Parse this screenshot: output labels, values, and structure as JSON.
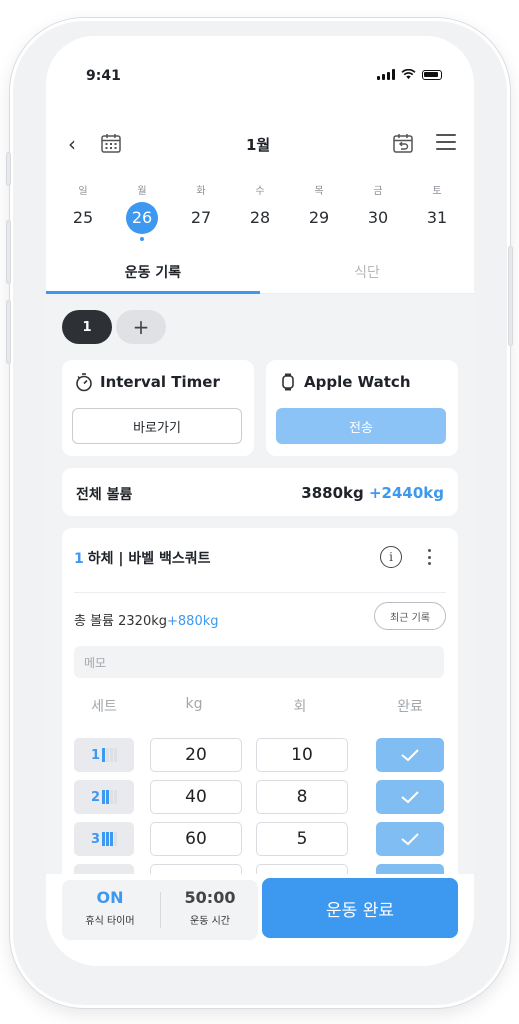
{
  "status_bar": {
    "time": "9:41"
  },
  "header": {
    "month": "1월"
  },
  "week": [
    {
      "label": "일",
      "date": "25",
      "selected": false
    },
    {
      "label": "월",
      "date": "26",
      "selected": true
    },
    {
      "label": "화",
      "date": "27",
      "selected": false
    },
    {
      "label": "수",
      "date": "28",
      "selected": false
    },
    {
      "label": "목",
      "date": "29",
      "selected": false
    },
    {
      "label": "금",
      "date": "30",
      "selected": false
    },
    {
      "label": "토",
      "date": "31",
      "selected": false
    }
  ],
  "tabs": {
    "workout": "운동 기록",
    "diet": "식단"
  },
  "session_tabs": {
    "current": "1",
    "add": "+"
  },
  "tools": {
    "interval": {
      "title": "Interval Timer",
      "button": "바로가기"
    },
    "watch": {
      "title": "Apple Watch",
      "button": "전송"
    }
  },
  "volume": {
    "label": "전체 볼륨",
    "value": "3880kg",
    "delta": "+2440kg"
  },
  "exercise": {
    "number": "1",
    "name": "하체 | 바벨 백스쿼트",
    "total_label": "총 볼륨 2320kg",
    "total_delta": "+880kg",
    "recent_button": "최근 기록",
    "memo_placeholder": "메모",
    "columns": {
      "set": "세트",
      "kg": "kg",
      "reps": "회",
      "done": "완료"
    },
    "sets": [
      {
        "set": "1",
        "kg": "20",
        "reps": "10",
        "done": true,
        "level": 1
      },
      {
        "set": "2",
        "kg": "40",
        "reps": "8",
        "done": true,
        "level": 2
      },
      {
        "set": "3",
        "kg": "60",
        "reps": "5",
        "done": true,
        "level": 3
      }
    ]
  },
  "bottom": {
    "rest_timer": {
      "value": "ON",
      "label": "휴식 타이머"
    },
    "workout_time": {
      "value": "50:00",
      "label": "운동 시간"
    },
    "finish_button": "운동 완료"
  },
  "colors": {
    "accent": "#3d98ef",
    "accent_light": "#8cc3f6",
    "dark_pill": "#2d3035"
  }
}
